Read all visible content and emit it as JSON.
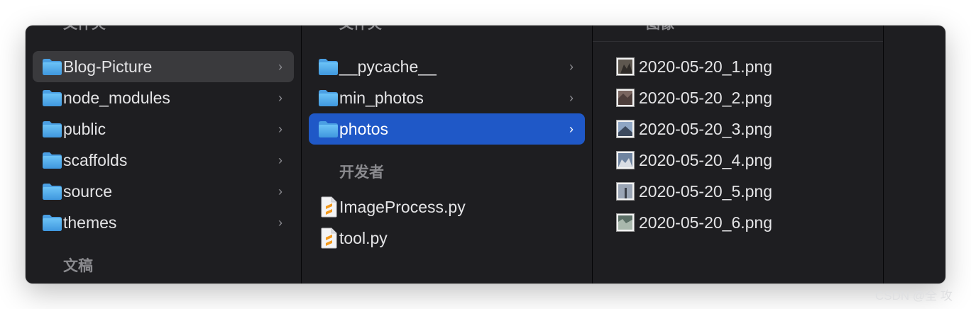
{
  "columns": [
    {
      "header": "文件夹",
      "items": [
        {
          "label": "Blog-Picture",
          "state": "selected-inactive",
          "has_children": true
        },
        {
          "label": "node_modules",
          "has_children": true
        },
        {
          "label": "public",
          "has_children": true
        },
        {
          "label": "scaffolds",
          "has_children": true
        },
        {
          "label": "source",
          "has_children": true
        },
        {
          "label": "themes",
          "has_children": true
        }
      ],
      "section": "文稿"
    },
    {
      "header": "文件夹",
      "items": [
        {
          "label": "__pycache__",
          "has_children": true
        },
        {
          "label": "min_photos",
          "has_children": true
        },
        {
          "label": "photos",
          "state": "selected-active",
          "has_children": true
        }
      ],
      "section": "开发者",
      "files": [
        {
          "label": "ImageProcess.py",
          "icon": "python-file-icon"
        },
        {
          "label": "tool.py",
          "icon": "python-file-icon"
        }
      ]
    },
    {
      "header": "图像",
      "files": [
        {
          "label": "2020-05-20_1.png"
        },
        {
          "label": "2020-05-20_2.png"
        },
        {
          "label": "2020-05-20_3.png"
        },
        {
          "label": "2020-05-20_4.png"
        },
        {
          "label": "2020-05-20_5.png"
        },
        {
          "label": "2020-05-20_6.png"
        }
      ]
    }
  ],
  "chevron": "›",
  "watermark": "CSDN @全 攻",
  "colors": {
    "window_bg": "#1e1e21",
    "selection_active": "#1f58c7",
    "selection_inactive": "#3a3a3d",
    "folder_blue": "#58b0ec",
    "text": "#e4e4e6",
    "header_text": "#8a8a8e"
  }
}
